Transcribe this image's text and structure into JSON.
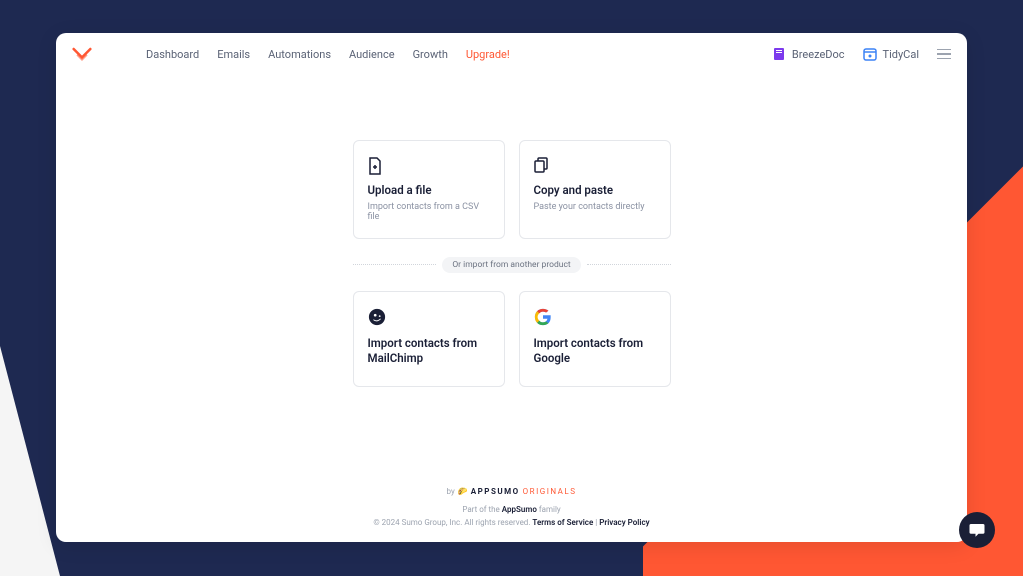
{
  "nav": {
    "items": [
      {
        "label": "Dashboard"
      },
      {
        "label": "Emails"
      },
      {
        "label": "Automations"
      },
      {
        "label": "Audience"
      },
      {
        "label": "Growth"
      },
      {
        "label": "Upgrade!"
      }
    ]
  },
  "shortcuts": {
    "breezedoc": "BreezeDoc",
    "tidycal": "TidyCal"
  },
  "cards": {
    "upload": {
      "title": "Upload a file",
      "subtitle": "Import contacts from a CSV file"
    },
    "paste": {
      "title": "Copy and paste",
      "subtitle": "Paste your contacts directly"
    },
    "mailchimp": {
      "title": "Import contacts from MailChimp"
    },
    "google": {
      "title": "Import contacts from Google"
    }
  },
  "divider": {
    "text": "Or import from another product"
  },
  "footer": {
    "by": "by",
    "appsumo": "APPSUMO",
    "originals": "ORIGINALS",
    "part_of": "Part of the ",
    "appsumo_link": "AppSumo",
    "family": " family",
    "copyright": "© 2024 Sumo Group, Inc. All rights reserved. ",
    "terms": "Terms of Service",
    "separator": " | ",
    "privacy": "Privacy Policy"
  }
}
